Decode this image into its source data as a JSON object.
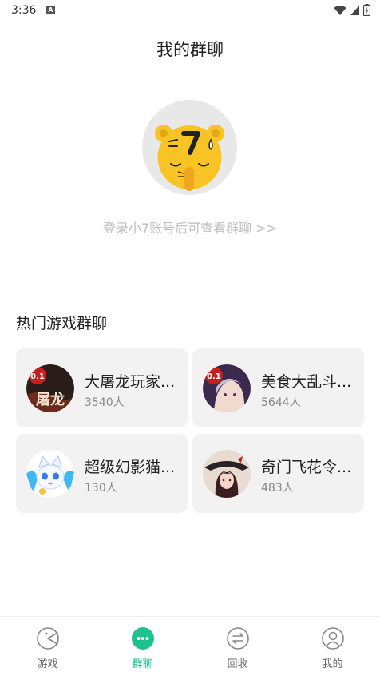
{
  "status_bar": {
    "time": "3:36",
    "notification_badge": "A"
  },
  "header": {
    "title": "我的群聊"
  },
  "login": {
    "prompt": "登录小7账号后可查看群聊 >>"
  },
  "hot_groups": {
    "title": "热门游戏群聊",
    "items": [
      {
        "name": "大屠龙玩家...",
        "count": "3540人",
        "icon": "game-avatar-tulong"
      },
      {
        "name": "美食大乱斗...",
        "count": "5644人",
        "icon": "game-avatar-meishi"
      },
      {
        "name": "超级幻影猫...",
        "count": "130人",
        "icon": "game-avatar-cat"
      },
      {
        "name": "奇门飞花令...",
        "count": "483人",
        "icon": "game-avatar-qimen"
      }
    ]
  },
  "nav": {
    "items": [
      {
        "label": "游戏",
        "icon": "game-pacman-icon",
        "active": false
      },
      {
        "label": "群聊",
        "icon": "chat-dots-icon",
        "active": true
      },
      {
        "label": "回收",
        "icon": "recycle-exchange-icon",
        "active": false
      },
      {
        "label": "我的",
        "icon": "profile-icon",
        "active": false
      }
    ]
  },
  "colors": {
    "accent": "#1dc38d",
    "mascot": "#f7c325",
    "card_bg": "#f2f2f2",
    "muted": "#bdbdbd"
  }
}
